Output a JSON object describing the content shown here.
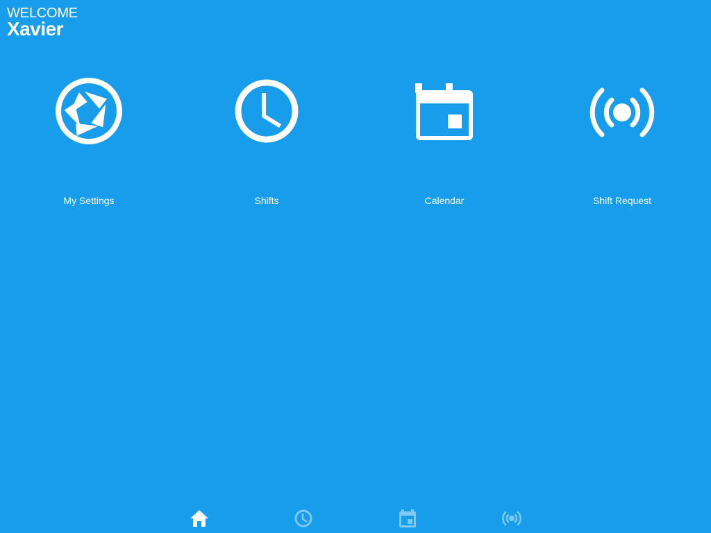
{
  "header": {
    "welcome": "WELCOME",
    "user_name": "Xavier"
  },
  "tiles": [
    {
      "label": "My Settings",
      "icon": "aperture-icon"
    },
    {
      "label": "Shifts",
      "icon": "clock-icon"
    },
    {
      "label": "Calendar",
      "icon": "calendar-icon"
    },
    {
      "label": "Shift Request",
      "icon": "broadcast-icon"
    }
  ],
  "bottom_nav": {
    "tabs": [
      {
        "icon": "home-icon",
        "active": true
      },
      {
        "icon": "clock-icon",
        "active": false
      },
      {
        "icon": "calendar-icon",
        "active": false
      },
      {
        "icon": "broadcast-icon",
        "active": false
      }
    ]
  },
  "colors": {
    "background": "#179dec",
    "foreground": "#ffffff"
  }
}
